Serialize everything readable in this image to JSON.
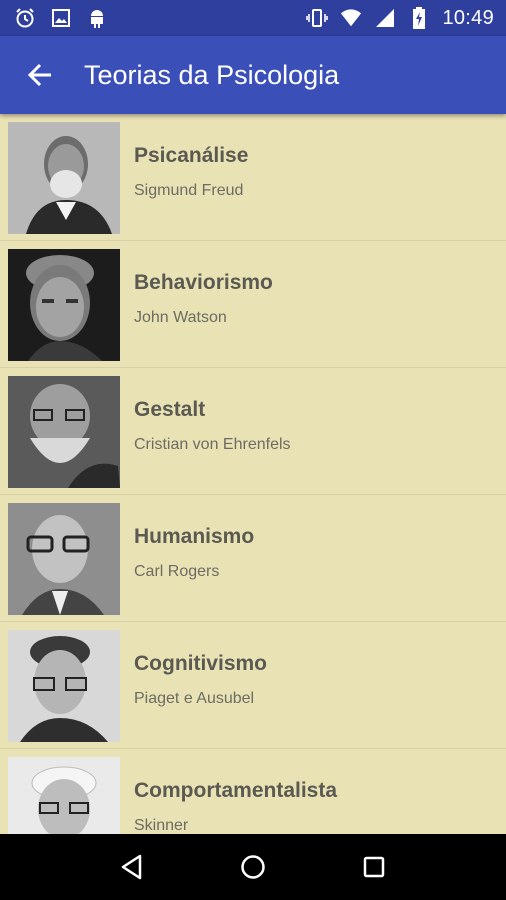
{
  "status_bar": {
    "time": "10:49",
    "left_icons": [
      "alarm-icon",
      "image-icon",
      "android-icon"
    ],
    "right_icons": [
      "vibrate-icon",
      "wifi-icon",
      "signal-icon",
      "battery-charging-icon"
    ]
  },
  "toolbar": {
    "title": "Teorias da Psicologia",
    "back_icon": "arrow-back-icon",
    "color": "#3a4fb8"
  },
  "theories": [
    {
      "title": "Psicanálise",
      "author": "Sigmund Freud",
      "image": "freud-portrait"
    },
    {
      "title": "Behaviorismo",
      "author": "John Watson",
      "image": "watson-portrait"
    },
    {
      "title": "Gestalt",
      "author": "Cristian von Ehrenfels",
      "image": "ehrenfels-portrait"
    },
    {
      "title": "Humanismo",
      "author": "Carl Rogers",
      "image": "rogers-portrait"
    },
    {
      "title": "Cognitivismo",
      "author": "Piaget e Ausubel",
      "image": "piaget-ausubel-portrait"
    },
    {
      "title": "Comportamentalista",
      "author": "Skinner",
      "image": "skinner-portrait"
    }
  ],
  "nav_bar": {
    "buttons": [
      "back-triangle-icon",
      "home-circle-icon",
      "recents-square-icon"
    ]
  },
  "colors": {
    "status_bar": "#2f3f9e",
    "background": "#e9e2b4",
    "title_text": "#5b5a52",
    "subtitle_text": "#6d6c63"
  }
}
